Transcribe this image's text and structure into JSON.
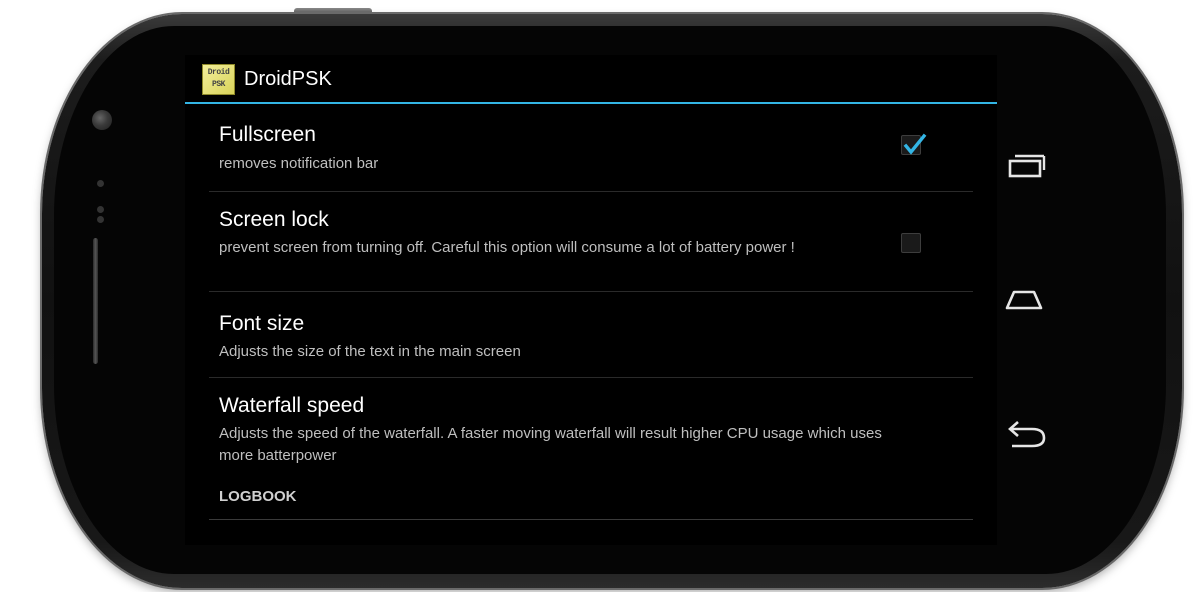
{
  "app": {
    "title": "DroidPSK",
    "icon_text_line1": "Droid",
    "icon_text_line2": "PSK"
  },
  "preferences": [
    {
      "title": "Fullscreen",
      "summary": "removes notification bar",
      "checkbox": true,
      "checked": true
    },
    {
      "title": "Screen lock",
      "summary": "prevent screen from turning off. Careful this option will consume a lot of battery power !",
      "checkbox": true,
      "checked": false
    },
    {
      "title": "Font size",
      "summary": "Adjusts the size of the text in the main screen",
      "checkbox": false
    },
    {
      "title": "Waterfall speed",
      "summary": "Adjusts the speed of the waterfall. A faster moving waterfall will result higher CPU usage which uses more batterpower",
      "checkbox": false
    }
  ],
  "category": {
    "label": "LOGBOOK"
  },
  "nav_keys": [
    "recent-apps-icon",
    "home-icon",
    "back-icon"
  ],
  "colors": {
    "accent": "#33b5e5",
    "background": "#000000",
    "title_text": "#ffffff",
    "summary_text": "#bfbfbf"
  }
}
